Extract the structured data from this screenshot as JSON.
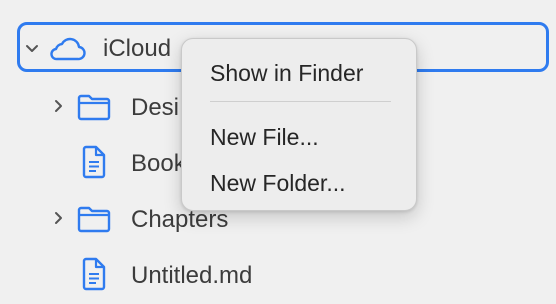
{
  "tree": {
    "root": {
      "label": "iCloud",
      "icon": "cloud-icon",
      "expanded": true
    },
    "items": [
      {
        "label": "Desi",
        "icon": "folder-icon",
        "collapsed": true
      },
      {
        "label": "Book",
        "icon": "document-icon"
      },
      {
        "label": "Chapters",
        "icon": "folder-icon",
        "collapsed": true
      },
      {
        "label": "Untitled.md",
        "icon": "document-icon"
      }
    ]
  },
  "context_menu": {
    "items": [
      "Show in Finder",
      "New File...",
      "New Folder..."
    ]
  },
  "colors": {
    "accent": "#2f7bef",
    "background": "#f0f0f0"
  }
}
